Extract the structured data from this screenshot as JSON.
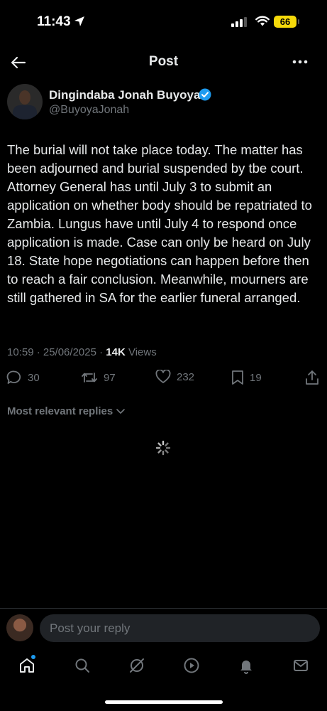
{
  "status_bar": {
    "time": "11:43",
    "battery": "66"
  },
  "header": {
    "title": "Post"
  },
  "author": {
    "name": "Dingindaba Jonah Buyoya",
    "handle": "@BuyoyaJonah"
  },
  "tweet": {
    "text": "The burial will not take place today. The matter has been adjourned and burial suspended by tbe court. Attorney General has until July 3 to submit an application on whether body should be repatriated to Zambia. Lungus have until July 4 to respond once application is made. Case can only be heard on July 18. State hope negotiations can happen before then to reach a fair conclusion. Meanwhile, mourners are still gathered in SA for the earlier funeral arranged.",
    "timestamp": "10:59 · 25/06/2025 · ",
    "views_count": "14K",
    "views_label": " Views"
  },
  "actions": {
    "replies": "30",
    "reposts": "97",
    "likes": "232",
    "bookmarks": "19"
  },
  "replies_filter": {
    "label": "Most relevant replies"
  },
  "reply_bar": {
    "placeholder": "Post your reply"
  },
  "colors": {
    "accent": "#1d9bf0",
    "muted": "#71767b",
    "battery": "#f5d90a"
  },
  "tabbar": {
    "icons": [
      "home-icon",
      "search-icon",
      "grok-icon",
      "video-icon",
      "notifications-icon",
      "messages-icon"
    ]
  }
}
